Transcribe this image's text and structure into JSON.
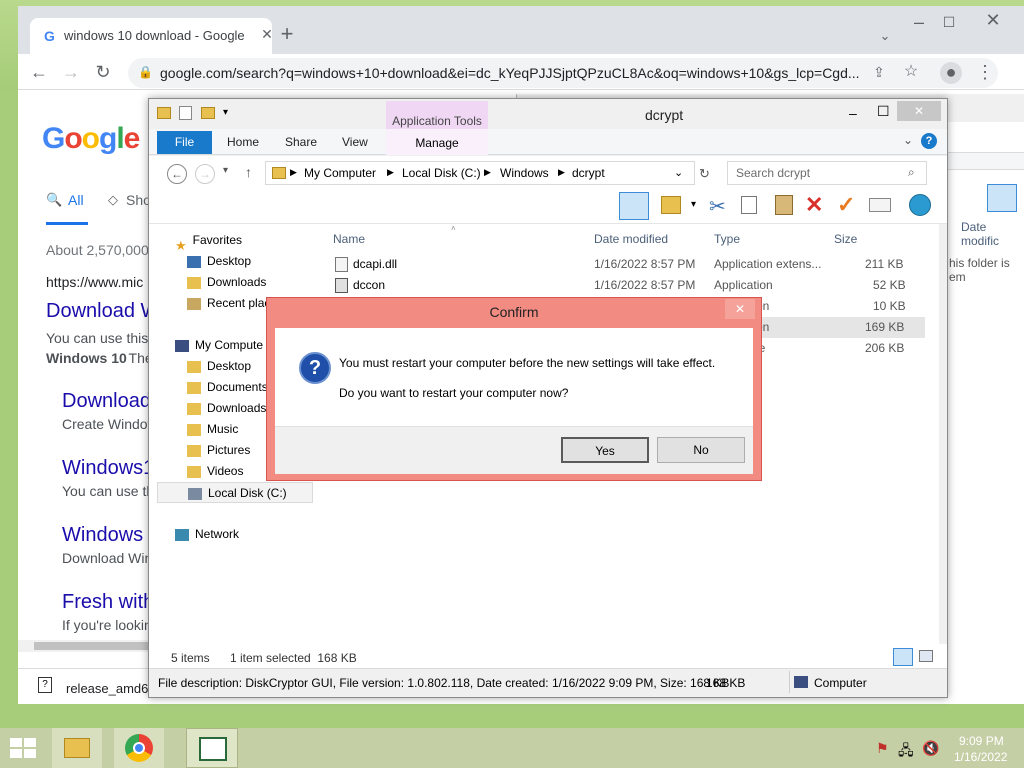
{
  "chrome": {
    "tab_title": "windows 10 download - Google",
    "url": "google.com/search?q=windows+10+download&ei=dc_kYeqPJJSjptQPzuCL8Ac&oq=windows+10&gs_lcp=Cgd...",
    "google_tabs": [
      "All",
      "Sho"
    ],
    "result_count": "About 2,570,000",
    "results": [
      {
        "cite": "https://www.mic",
        "title": "Download W",
        "snippet": "You can use this",
        "snippet2_bold": "Windows 10",
        "snippet2_rest": ". The"
      },
      {
        "title": "Download",
        "snippet": "Create Window"
      },
      {
        "title": "Windows1",
        "snippet": "You can use th"
      },
      {
        "title": "Windows",
        "snippet": "Download Win"
      },
      {
        "title": "Fresh with",
        "snippet": "If you're lookin"
      }
    ],
    "download_file": "release_amd64"
  },
  "bg_window": {
    "column": "Date modific",
    "empty_text": "his folder is em"
  },
  "explorer": {
    "title": "dcrypt",
    "app_tools": "Application Tools",
    "tabs": [
      "File",
      "Home",
      "Share",
      "View",
      "Manage"
    ],
    "path": [
      "My Computer",
      "Local Disk (C:)",
      "Windows",
      "dcrypt"
    ],
    "search_placeholder": "Search dcrypt",
    "nav": {
      "favorites": "Favorites",
      "fav_items": [
        "Desktop",
        "Downloads",
        "Recent plac"
      ],
      "computer": "My Compute",
      "comp_items": [
        "Desktop",
        "Documents",
        "Downloads",
        "Music",
        "Pictures",
        "Videos",
        "Local Disk (C:)"
      ],
      "network": "Network"
    },
    "columns": [
      "Name",
      "Date modified",
      "Type",
      "Size"
    ],
    "files": [
      {
        "name": "dcapi.dll",
        "date": "1/16/2022 8:57 PM",
        "type": "Application extens...",
        "size": "211 KB"
      },
      {
        "name": "dccon",
        "date": "1/16/2022 8:57 PM",
        "type": "Application",
        "size": "52 KB"
      },
      {
        "name": "",
        "date": "",
        "type": "on",
        "size": "10 KB"
      },
      {
        "name": "",
        "date": "",
        "type": "on",
        "size": "169 KB"
      },
      {
        "name": "",
        "date": "",
        "type": "le",
        "size": "206 KB"
      }
    ],
    "status_items": "5 items",
    "status_selected": "1 item selected  168 KB",
    "details": "File description: DiskCryptor GUI, File version: 1.0.802.118, Date created: 1/16/2022 9:09 PM, Size: 168 KB",
    "details_size": "168 KB",
    "details_location": "Computer"
  },
  "confirm": {
    "title": "Confirm",
    "message1": "You must restart your computer before the new settings will take effect.",
    "message2": "Do you want to restart your computer now?",
    "yes": "Yes",
    "no": "No"
  },
  "taskbar": {
    "time": "9:09 PM",
    "date": "1/16/2022"
  }
}
